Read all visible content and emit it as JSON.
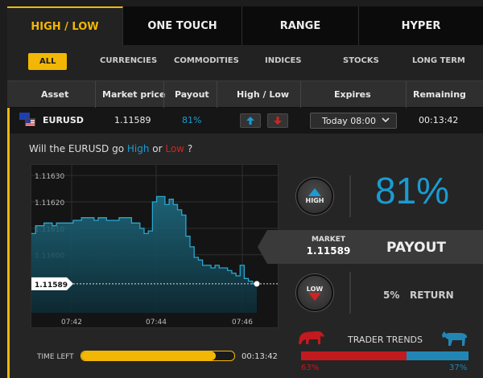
{
  "tabs": [
    {
      "label": "HIGH / LOW",
      "active": true
    },
    {
      "label": "ONE TOUCH"
    },
    {
      "label": "RANGE"
    },
    {
      "label": "HYPER"
    }
  ],
  "filters": [
    "ALL",
    "CURRENCIES",
    "COMMODITIES",
    "INDICES",
    "STOCKS",
    "LONG TERM"
  ],
  "table": {
    "headers": [
      "Asset",
      "Market price",
      "Payout",
      "High / Low",
      "Expires",
      "Remaining"
    ]
  },
  "row": {
    "asset": "EURUSD",
    "market_price": "1.11589",
    "payout": "81%",
    "expires": "Today 08:00",
    "remaining": "00:13:42"
  },
  "question": {
    "prefix": "Will the EURUSD go ",
    "high": "High",
    "or": " or ",
    "low": "Low",
    "suffix": " ?"
  },
  "chart": {
    "y_ticks": [
      "1.11630",
      "1.11620",
      "1.11610",
      "1.11600"
    ],
    "x_ticks": [
      "07:42",
      "07:44",
      "07:46"
    ],
    "current_label": "1.11589"
  },
  "buttons": {
    "high": "HIGH",
    "low": "LOW"
  },
  "payout_panel": {
    "percent": "81%",
    "market_label": "MARKET",
    "market_value": "1.11589",
    "payout_label": "PAYOUT",
    "return_pct": "5%",
    "return_label": "RETURN"
  },
  "time_left": {
    "label": "TIME LEFT",
    "value": "00:13:42",
    "progress": 0.88
  },
  "trader_trends": {
    "label": "TRADER TRENDS",
    "bear_pct": "63%",
    "bull_pct": "37%",
    "bear_fraction": 0.63
  },
  "colors": {
    "accent": "#f2b705",
    "high": "#1a9bd1",
    "low": "#d42222"
  },
  "chart_data": {
    "type": "area",
    "y_ticks": [
      1.1163,
      1.1162,
      1.1161,
      1.116
    ],
    "ylim": [
      1.11578,
      1.11634
    ],
    "series": [
      {
        "values": [
          1.11608,
          1.11611,
          1.11611,
          1.11612,
          1.11612,
          1.11611,
          1.11612,
          1.11612,
          1.11612,
          1.11612,
          1.11613,
          1.11613,
          1.11614,
          1.11614,
          1.11614,
          1.11613,
          1.11614,
          1.11614,
          1.11613,
          1.11613,
          1.11613,
          1.11614,
          1.11614,
          1.11614,
          1.11612,
          1.11612,
          1.1161,
          1.11608,
          1.11609,
          1.1162,
          1.11622,
          1.11622,
          1.11619,
          1.11621,
          1.11619,
          1.11617,
          1.11615,
          1.11607,
          1.11603,
          1.11599,
          1.11598,
          1.11596,
          1.11596,
          1.11595,
          1.11596,
          1.11595,
          1.11595,
          1.11594,
          1.11593,
          1.11592,
          1.11596,
          1.11591,
          1.1159,
          1.11589
        ]
      }
    ]
  }
}
